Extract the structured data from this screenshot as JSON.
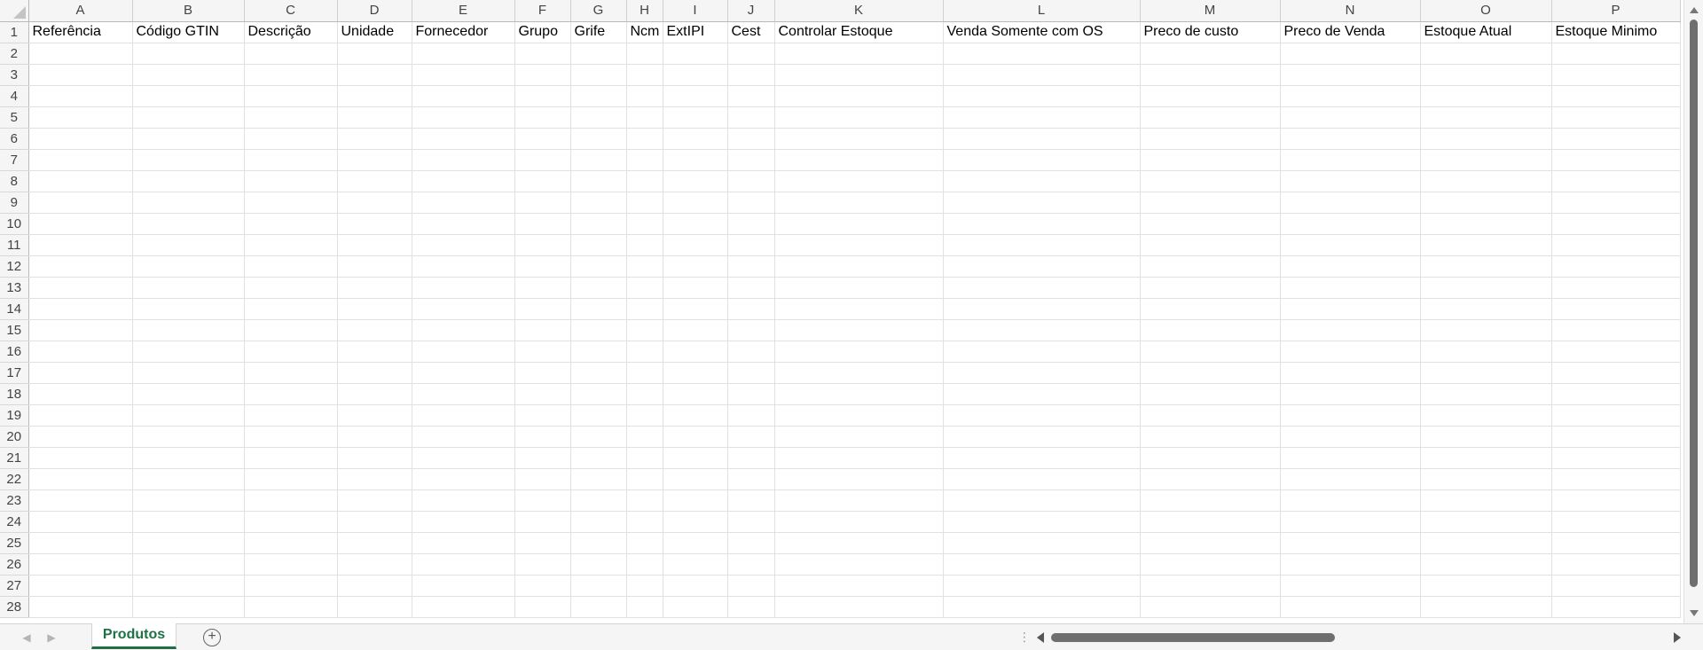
{
  "sheet": {
    "column_letters": [
      "A",
      "B",
      "C",
      "D",
      "E",
      "F",
      "G",
      "H",
      "I",
      "J",
      "K",
      "L",
      "M",
      "N",
      "O",
      "P"
    ],
    "headers": [
      "Referência",
      "Código GTIN",
      "Descrição",
      "Unidade",
      "Fornecedor",
      "Grupo",
      "Grife",
      "Ncm",
      "ExtIPI",
      "Cest",
      "Controlar Estoque",
      "Venda Somente com OS",
      "Preco de custo",
      "Preco de Venda",
      "Estoque Atual",
      "Estoque Minimo"
    ],
    "row_numbers": [
      "1",
      "2",
      "3",
      "4",
      "5",
      "6",
      "7",
      "8",
      "9",
      "10",
      "11",
      "12",
      "13",
      "14",
      "15",
      "16",
      "17",
      "18",
      "19",
      "20",
      "21",
      "22",
      "23",
      "24",
      "25",
      "26",
      "27",
      "28"
    ]
  },
  "tabs": [
    {
      "label": "Produtos",
      "active": true
    }
  ],
  "colors": {
    "tab_accent": "#1e7145",
    "grid_line": "#e1e1e1",
    "header_bg": "#f5f5f5"
  },
  "icons": {
    "add_sheet": "plus-circle-icon",
    "prev_sheet": "chevron-left-icon",
    "next_sheet": "chevron-right-icon"
  }
}
